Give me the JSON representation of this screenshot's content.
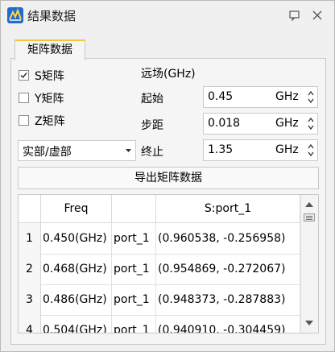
{
  "window": {
    "title": "结果数据",
    "pin_icon": "pin-icon",
    "close_icon": "close-icon"
  },
  "tab": {
    "label": "矩阵数据"
  },
  "checkboxes": [
    {
      "label": "S矩阵",
      "checked": true
    },
    {
      "label": "Y矩阵",
      "checked": false
    },
    {
      "label": "Z矩阵",
      "checked": false
    }
  ],
  "farfield": {
    "heading": "远场(GHz)",
    "start": {
      "label": "起始",
      "value": "0.45",
      "unit": "GHz"
    },
    "step": {
      "label": "步距",
      "value": "0.018",
      "unit": "GHz"
    },
    "stop": {
      "label": "终止",
      "value": "1.35",
      "unit": "GHz"
    }
  },
  "part_select": {
    "value": "实部/虚部"
  },
  "export_button": {
    "label": "导出矩阵数据"
  },
  "table": {
    "headers": [
      "Freq",
      "",
      "S:port_1"
    ],
    "rows": [
      {
        "num": "1",
        "freq": "0.450(GHz)",
        "port": "port_1",
        "value": "(0.960538, -0.256958)"
      },
      {
        "num": "2",
        "freq": "0.468(GHz)",
        "port": "port_1",
        "value": "(0.954869, -0.272067)"
      },
      {
        "num": "3",
        "freq": "0.486(GHz)",
        "port": "port_1",
        "value": "(0.948373, -0.287883)"
      },
      {
        "num": "4",
        "freq": "0.504(GHz)",
        "port": "port_1",
        "value": "(0.940910, -0.304459)"
      }
    ]
  },
  "colors": {
    "accent_tab": "#f6c341",
    "app_icon": "#1f6bd1"
  }
}
